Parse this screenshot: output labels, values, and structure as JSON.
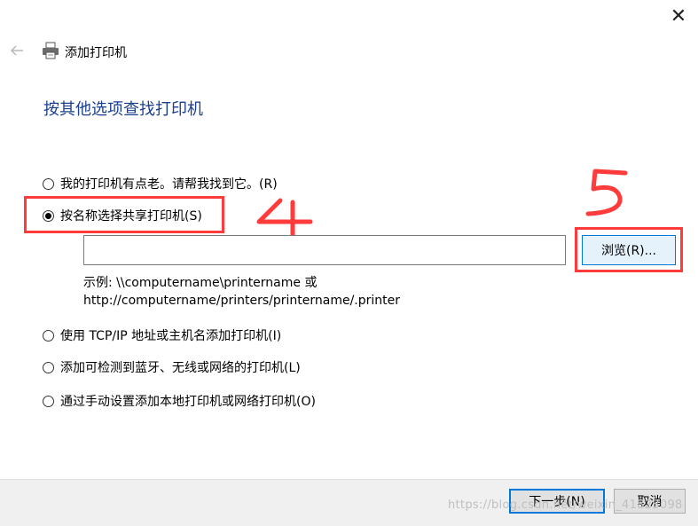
{
  "window": {
    "title": "添加打印机",
    "close_glyph": "✕"
  },
  "heading": "按其他选项查找打印机",
  "options": [
    {
      "label": "我的打印机有点老。请帮我找到它。(R)",
      "checked": false
    },
    {
      "label": "按名称选择共享打印机(S)",
      "checked": true
    },
    {
      "label": "使用 TCP/IP 地址或主机名添加打印机(I)",
      "checked": false
    },
    {
      "label": "添加可检测到蓝牙、无线或网络的打印机(L)",
      "checked": false
    },
    {
      "label": "通过手动设置添加本地打印机或网络打印机(O)",
      "checked": false
    }
  ],
  "shared_printer": {
    "input_value": "",
    "browse_label": "浏览(R)...",
    "example_line1": "示例: \\\\computername\\printername 或",
    "example_line2": "http://computername/printers/printername/.printer"
  },
  "annotations": {
    "step4": "4",
    "step5": "5",
    "highlight_color": "#ff3b3b"
  },
  "footer": {
    "next_label": "下一步(N)",
    "cancel_label": "取消"
  },
  "watermark": "https://blog.csdn.net/weixin_41823098",
  "colors": {
    "heading": "#1a3f8f",
    "accent": "#0078d7"
  }
}
